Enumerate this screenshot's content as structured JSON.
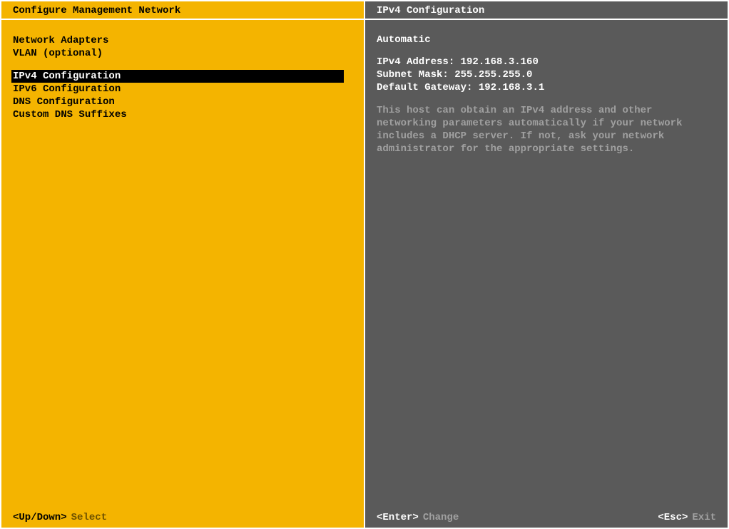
{
  "left": {
    "title": "Configure Management Network",
    "groups": [
      {
        "items": [
          {
            "label": "Network Adapters",
            "selected": false
          },
          {
            "label": "VLAN (optional)",
            "selected": false
          }
        ]
      },
      {
        "items": [
          {
            "label": "IPv4 Configuration",
            "selected": true
          },
          {
            "label": "IPv6 Configuration",
            "selected": false
          },
          {
            "label": "DNS Configuration",
            "selected": false
          },
          {
            "label": "Custom DNS Suffixes",
            "selected": false
          }
        ]
      }
    ],
    "footer": {
      "key": "<Up/Down>",
      "action": "Select"
    }
  },
  "right": {
    "title": "IPv4 Configuration",
    "mode": "Automatic",
    "fields": {
      "ipv4_label": "IPv4 Address:",
      "ipv4_value": "192.168.3.160",
      "mask_label": "Subnet Mask:",
      "mask_value": "255.255.255.0",
      "gw_label": "Default Gateway:",
      "gw_value": "192.168.3.1"
    },
    "description": "This host can obtain an IPv4 address and other networking parameters automatically if your network includes a DHCP server. If not, ask your network administrator for the appropriate settings.",
    "footer_left": {
      "key": "<Enter>",
      "action": "Change"
    },
    "footer_right": {
      "key": "<Esc>",
      "action": "Exit"
    }
  }
}
